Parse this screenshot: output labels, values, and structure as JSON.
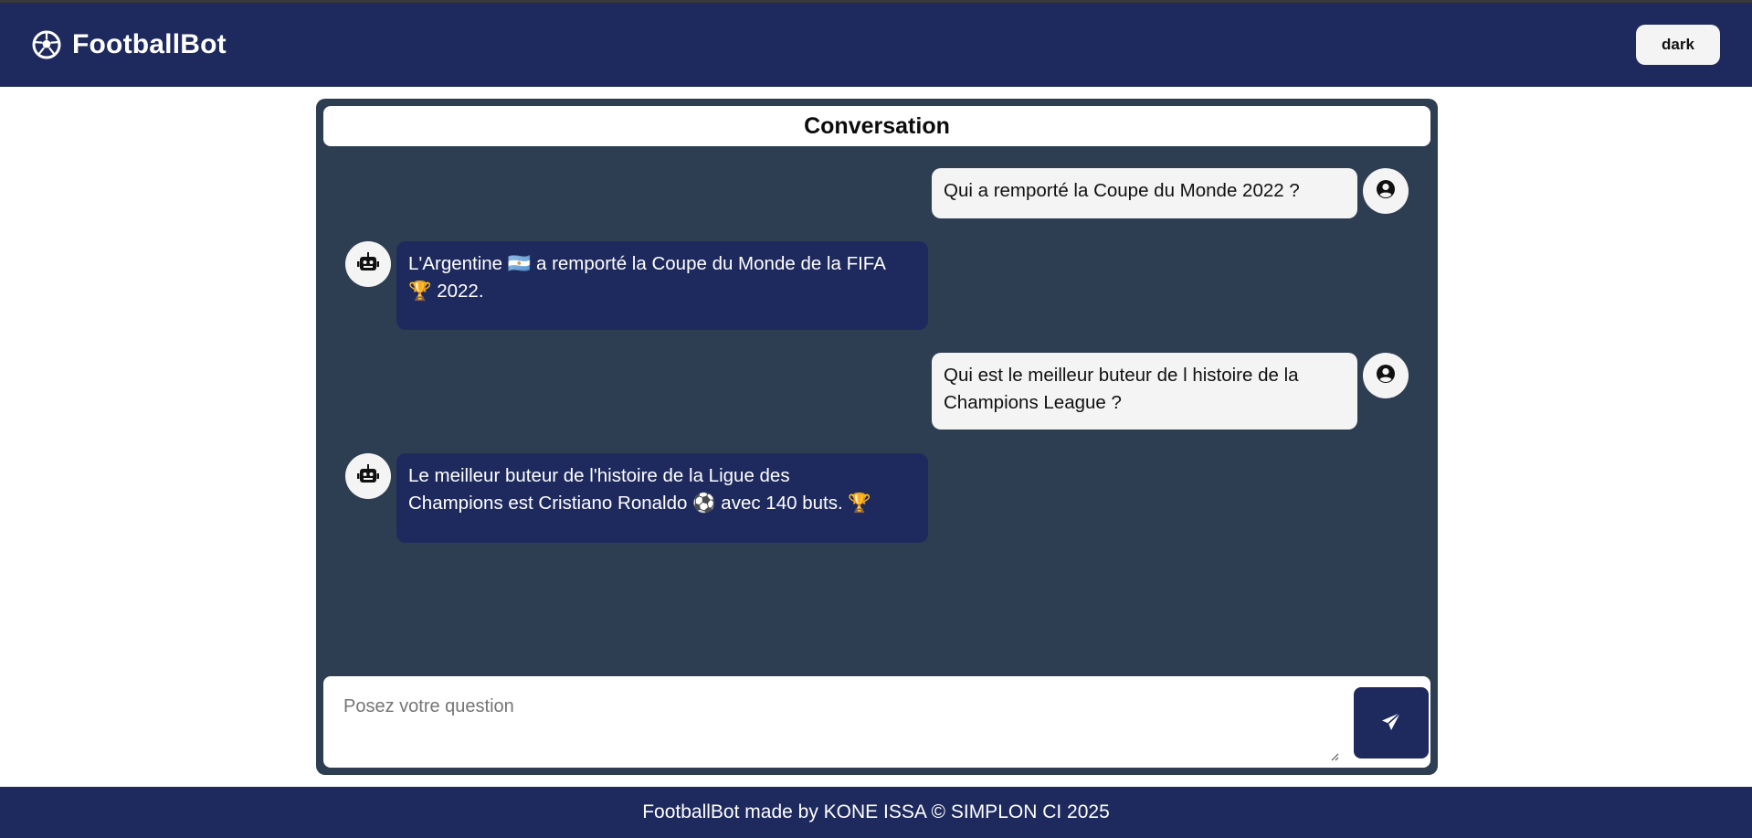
{
  "app": {
    "title": "FootballBot",
    "logo_icon": "soccer-ball-icon"
  },
  "header": {
    "theme_toggle_label": "dark"
  },
  "conversation": {
    "title": "Conversation",
    "messages": [
      {
        "role": "user",
        "icon": "user-circle-icon",
        "text": "Qui a remporté la Coupe du Monde 2022 ?"
      },
      {
        "role": "bot",
        "icon": "robot-icon",
        "line1": "L'Argentine 🇦🇷 a remporté la Coupe du Monde de la FIFA",
        "line2": "🏆 2022."
      },
      {
        "role": "user",
        "icon": "user-circle-icon",
        "line1": "Qui est le meilleur buteur de l histoire de la",
        "line2": "Champions League ?"
      },
      {
        "role": "bot",
        "icon": "robot-icon",
        "line1": "Le meilleur buteur de l'histoire de la Ligue des",
        "line2": "Champions est Cristiano Ronaldo ⚽ avec 140 buts. 🏆"
      }
    ]
  },
  "input": {
    "placeholder": "Posez votre question",
    "value": "",
    "send_icon": "paper-plane-icon"
  },
  "footer": {
    "text": "FootballBot made by KONE ISSA © SIMPLON CI 2025"
  },
  "colors": {
    "primary": "#1e2a5e",
    "panel": "#2e3e52",
    "bubble_user": "#f4f4f4"
  }
}
